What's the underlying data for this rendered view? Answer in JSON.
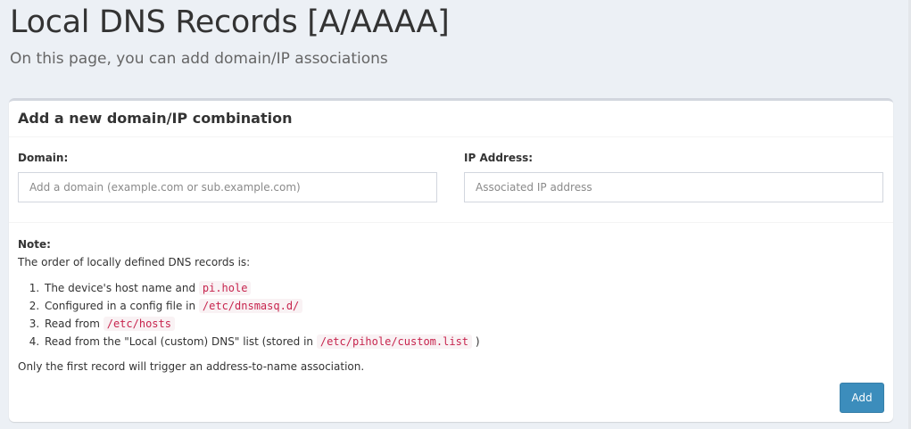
{
  "header": {
    "title": "Local DNS Records [A/AAAA]",
    "subtitle": "On this page, you can add domain/IP associations"
  },
  "form": {
    "title": "Add a new domain/IP combination",
    "domain_label": "Domain:",
    "domain_placeholder": "Add a domain (example.com or sub.example.com)",
    "domain_value": "",
    "ip_label": "IP Address:",
    "ip_placeholder": "Associated IP address",
    "ip_value": ""
  },
  "note": {
    "title": "Note:",
    "intro": "The order of locally defined DNS records is:",
    "items": [
      {
        "text": "The device's host name and ",
        "code": "pi.hole",
        "suffix": ""
      },
      {
        "text": "Configured in a config file in ",
        "code": "/etc/dnsmasq.d/",
        "suffix": ""
      },
      {
        "text": "Read from ",
        "code": "/etc/hosts",
        "suffix": ""
      },
      {
        "text": "Read from the \"Local (custom) DNS\" list (stored in ",
        "code": "/etc/pihole/custom.list",
        "suffix": ")"
      }
    ],
    "footer": "Only the first record will trigger an address-to-name association."
  },
  "actions": {
    "add_label": "Add"
  },
  "colors": {
    "primary_button": "#3c8dbc",
    "code_text": "#c7254e",
    "background": "#ecf0f5"
  }
}
